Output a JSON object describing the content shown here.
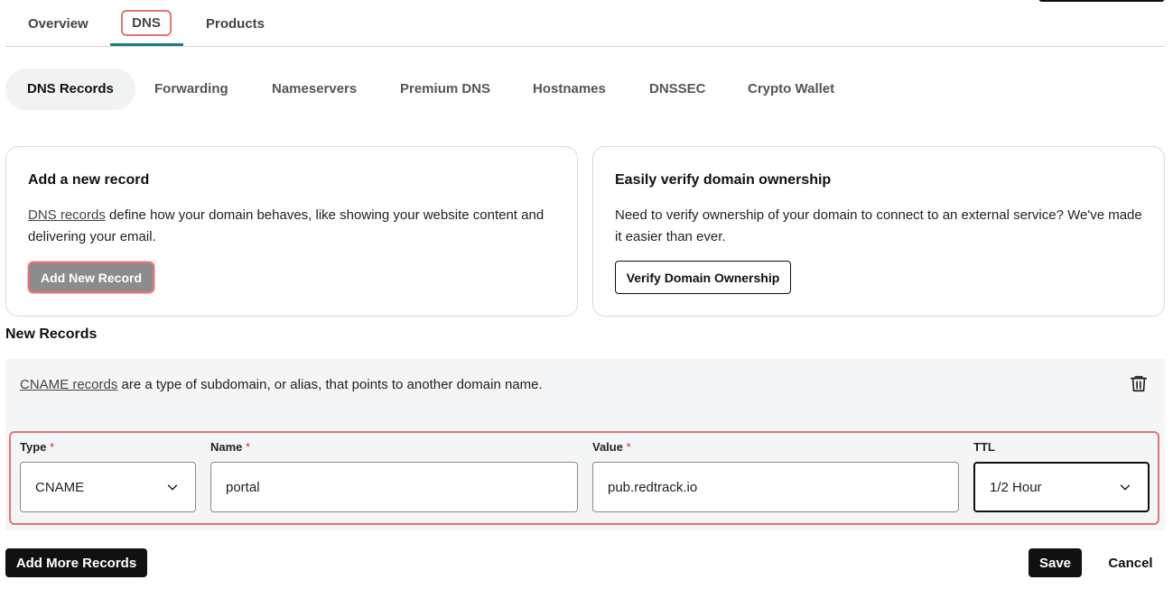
{
  "top_tabs": [
    {
      "label": "Overview"
    },
    {
      "label": "DNS"
    },
    {
      "label": "Products"
    }
  ],
  "subnav": [
    {
      "label": "DNS Records"
    },
    {
      "label": "Forwarding"
    },
    {
      "label": "Nameservers"
    },
    {
      "label": "Premium DNS"
    },
    {
      "label": "Hostnames"
    },
    {
      "label": "DNSSEC"
    },
    {
      "label": "Crypto Wallet"
    }
  ],
  "add_card": {
    "title": "Add a new record",
    "link_text": "DNS records",
    "desc_rest": " define how your domain behaves, like showing your website content and delivering your email.",
    "button_label": "Add New Record"
  },
  "verify_card": {
    "title": "Easily verify domain ownership",
    "desc": "Need to verify ownership of your domain to connect to an external service? We've made it easier than ever.",
    "button_label": "Verify Domain Ownership"
  },
  "new_records": {
    "title": "New Records",
    "link_text": "CNAME records",
    "desc_rest": " are a type of subdomain, or alias, that points to another domain name.",
    "required_marker": "*",
    "fields": {
      "type": {
        "label": "Type",
        "value": "CNAME"
      },
      "name": {
        "label": "Name",
        "value": "portal"
      },
      "value": {
        "label": "Value",
        "value": "pub.redtrack.io"
      },
      "ttl": {
        "label": "TTL",
        "value": "1/2 Hour"
      }
    }
  },
  "actions": {
    "add_more_label": "Add More Records",
    "save_label": "Save",
    "cancel_label": "Cancel"
  },
  "colors": {
    "accent": "#1d7a80",
    "highlight": "#e57373",
    "required": "#d32f2f"
  }
}
